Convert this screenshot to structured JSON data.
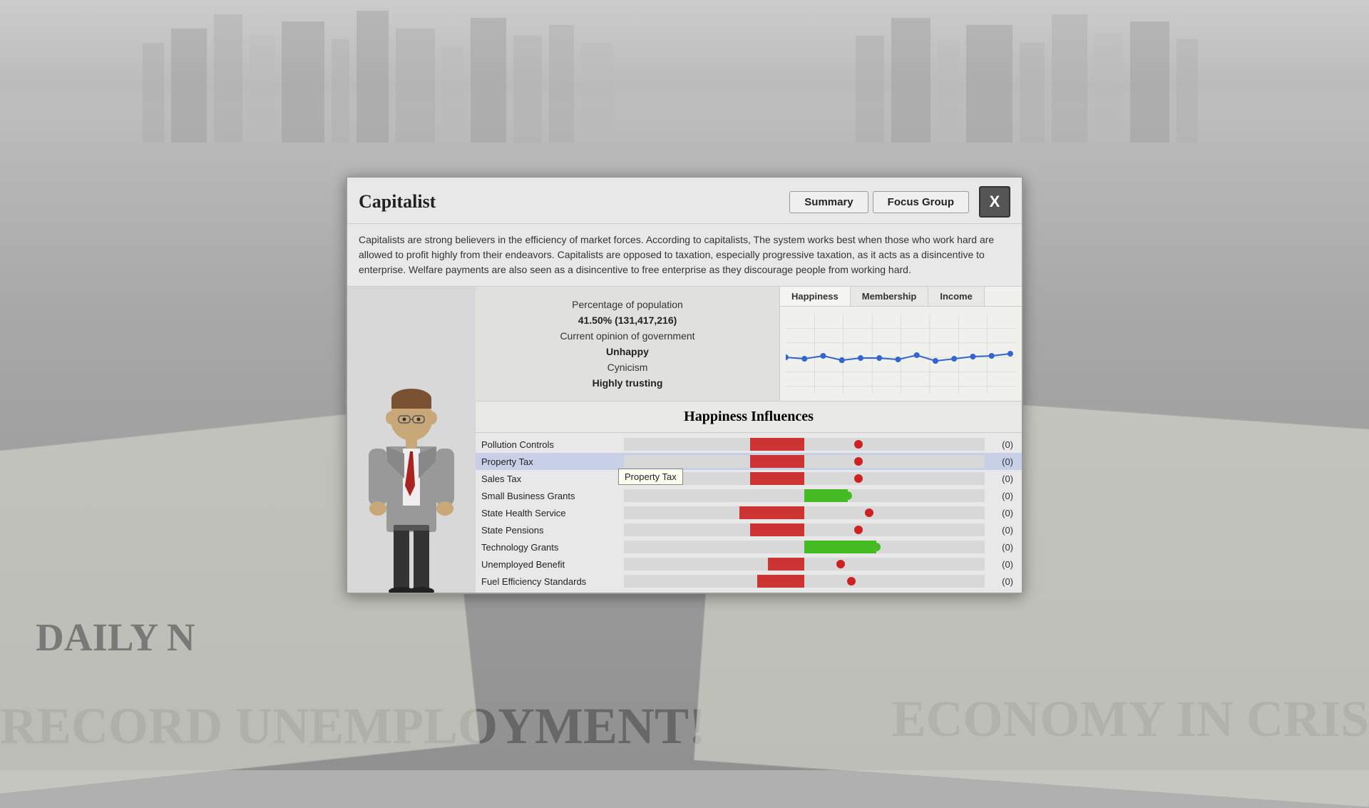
{
  "background": {
    "newspaper_left_text": "RECORD UNEMPLOYMENT!",
    "newspaper_right_text": "ECONOMY IN CRIS",
    "newspaper_sub_left": "DAILY N"
  },
  "dialog": {
    "title": "Capitalist",
    "description": "Capitalists are strong believers in the efficiency of market forces. According to capitalists, The system works best when those who work hard are allowed to profit highly from their endeavors. Capitalists are opposed to taxation, especially progressive taxation, as it acts as a disincentive to enterprise. Welfare payments are also seen as a disincentive to free enterprise as they discourage people from working hard.",
    "tabs": [
      {
        "id": "summary",
        "label": "Summary"
      },
      {
        "id": "focus_group",
        "label": "Focus Group"
      }
    ],
    "close_label": "X",
    "stats": {
      "percentage_label": "Percentage of population",
      "percentage_value": "41.50% (131,417,216)",
      "opinion_label": "Current opinion of government",
      "opinion_value": "Unhappy",
      "cynicism_label": "Cynicism",
      "cynicism_value": "Highly trusting"
    },
    "chart_tabs": [
      {
        "id": "happiness",
        "label": "Happiness",
        "active": true
      },
      {
        "id": "membership",
        "label": "Membership"
      },
      {
        "id": "income",
        "label": "Income"
      }
    ],
    "influences_title": "Happiness Influences",
    "influences": [
      {
        "name": "Pollution Controls",
        "type": "negative",
        "magnitude": 0.15,
        "score": "(0)"
      },
      {
        "name": "Property Tax",
        "type": "negative",
        "magnitude": 0.15,
        "score": "(0)",
        "highlighted": true,
        "tooltip": "Property Tax"
      },
      {
        "name": "Sales Tax",
        "type": "negative",
        "magnitude": 0.15,
        "score": "(0)"
      },
      {
        "name": "Small Business Grants",
        "type": "positive",
        "magnitude": 0.12,
        "score": "(0)"
      },
      {
        "name": "State Health Service",
        "type": "negative",
        "magnitude": 0.18,
        "score": "(0)"
      },
      {
        "name": "State Pensions",
        "type": "negative",
        "magnitude": 0.15,
        "score": "(0)"
      },
      {
        "name": "Technology Grants",
        "type": "positive",
        "magnitude": 0.2,
        "score": "(0)"
      },
      {
        "name": "Unemployed Benefit",
        "type": "negative",
        "magnitude": 0.1,
        "score": "(0)"
      },
      {
        "name": "Fuel Efficiency Standards",
        "type": "negative",
        "magnitude": 0.13,
        "score": "(0)"
      }
    ],
    "chart_data": {
      "points": [
        0.55,
        0.52,
        0.53,
        0.51,
        0.52,
        0.52,
        0.51,
        0.53,
        0.5,
        0.51,
        0.52,
        0.53,
        0.54
      ]
    }
  }
}
